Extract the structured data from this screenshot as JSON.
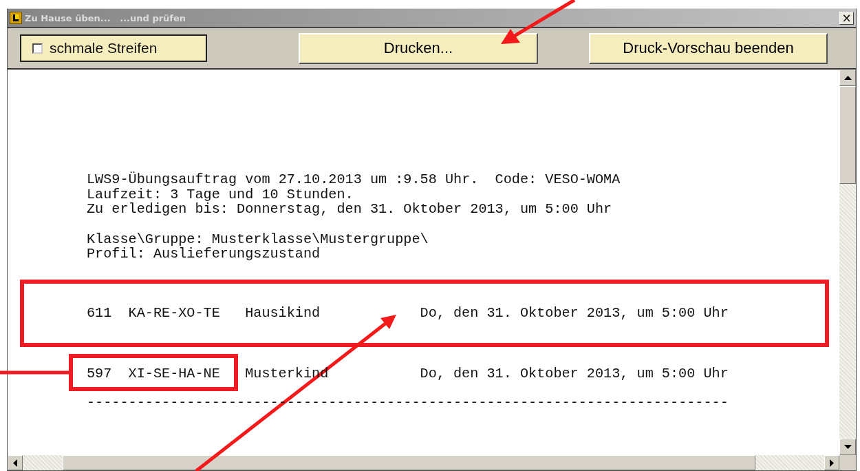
{
  "window": {
    "title": "Zu Hause üben...   ...und prüfen",
    "close": "×"
  },
  "toolbar": {
    "checkbox": {
      "label": "schmale Streifen",
      "checked": false
    },
    "buttons": [
      "Drucken...",
      "Druck-Vorschau beenden"
    ]
  },
  "document": {
    "header_lines": [
      [
        "LWS9-Übungsauftrag vom 27.10.2013 um :9.58 Uhr.  Code: VESO-WOMA",
        "Laufzeit: 3 Tage und 10 Stunden.",
        "Zu erledigen bis: Donnerstag, den 31. Oktober 2013, um 5:00 Uhr"
      ],
      [
        "Klasse\\Gruppe: Musterklasse\\Mustergruppe\\",
        "Profil: Auslieferungszustand"
      ]
    ],
    "rows": [
      {
        "number": "611",
        "code": "KA-RE-XO-TE",
        "name": "Hausikind",
        "due": "Do, den 31. Oktober 2013, um 5:00 Uhr"
      },
      {
        "number": "597",
        "code": "XI-SE-HA-NE",
        "name": "Musterkind",
        "due": "Do, den 31. Oktober 2013, um 5:00 Uhr"
      }
    ],
    "separator": "-----------------------------------------------------------------------------"
  }
}
